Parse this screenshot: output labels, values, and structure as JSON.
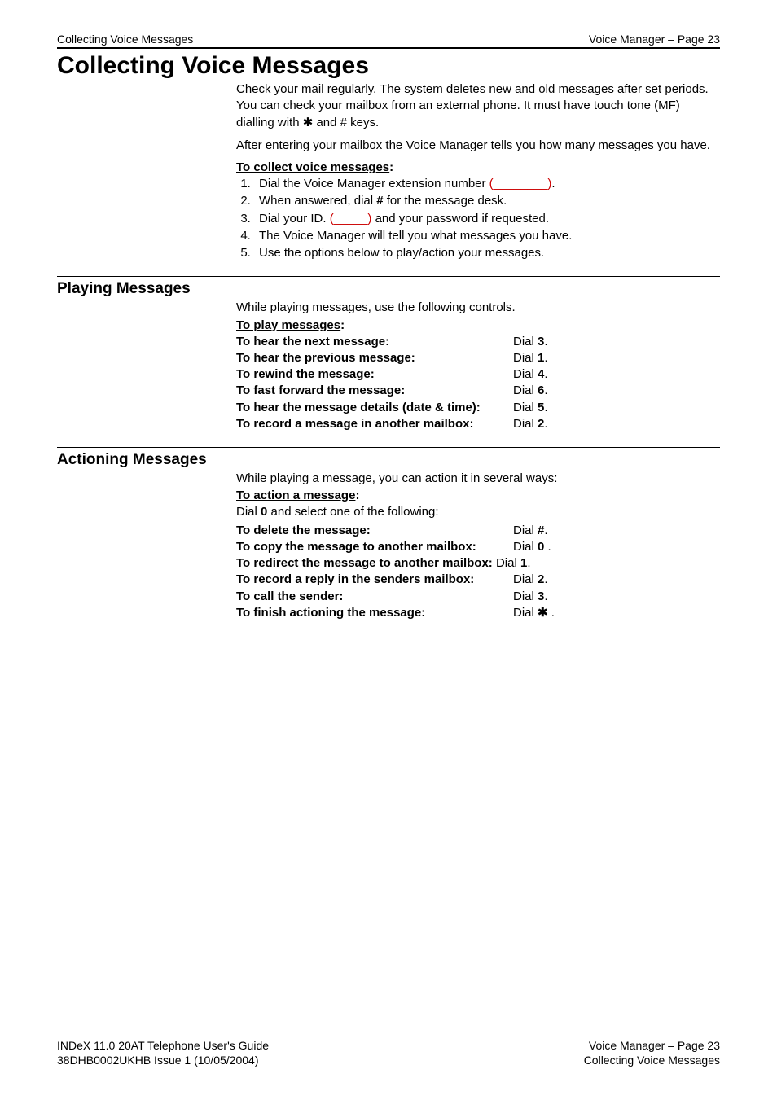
{
  "header": {
    "left": "Collecting Voice Messages",
    "right": "Voice Manager – Page 23"
  },
  "title": "Collecting Voice Messages",
  "intro": {
    "p1_a": "Check your mail regularly. The system deletes new and old messages after set periods. You can check your mailbox from an external phone. It must have touch tone (MF) dialling with ",
    "p1_star": "✱",
    "p1_b": " and # keys.",
    "p2": "After entering your mailbox the Voice Manager tells you how many messages you have."
  },
  "collect": {
    "heading": "To collect voice messages",
    "colon": ":",
    "step1_a": "Dial the Voice Manager extension number ",
    "step1_blank": "(________)",
    "step1_b": ".",
    "step2_a": "When answered, dial ",
    "step2_hash": "#",
    "step2_b": " for the message desk.",
    "step3_a": "Dial your ID. ",
    "step3_blank": "(_____)",
    "step3_b": " and your password if requested.",
    "step4": "The Voice Manager will tell you what messages you have.",
    "step5": "Use the options below to play/action your messages."
  },
  "playing": {
    "heading": "Playing Messages",
    "intro": "While playing messages, use the following controls.",
    "sub": "To play messages",
    "colon": ":",
    "rows": [
      {
        "label": "To hear the next message:",
        "pre": "Dial ",
        "key": "3",
        "post": "."
      },
      {
        "label": "To hear the previous message:",
        "pre": "Dial ",
        "key": "1",
        "post": "."
      },
      {
        "label": "To rewind the message:",
        "pre": "Dial ",
        "key": "4",
        "post": "."
      },
      {
        "label": "To fast forward the message:",
        "pre": "Dial ",
        "key": "6",
        "post": "."
      },
      {
        "label": "To hear the message details (date & time):",
        "pre": "Dial ",
        "key": "5",
        "post": "."
      },
      {
        "label": "To record a message in another mailbox:",
        "pre": "Dial ",
        "key": "2",
        "post": "."
      }
    ]
  },
  "actioning": {
    "heading": "Actioning Messages",
    "intro": "While playing a message, you can action it in several ways:",
    "sub": "To action a message",
    "colon": ":",
    "dial0_a": "Dial ",
    "dial0_key": "0",
    "dial0_b": " and select one of the following:",
    "rows": [
      {
        "label": "To delete the message:",
        "pre": "Dial ",
        "key": "#",
        "post": "."
      },
      {
        "label": "To copy the message to another mailbox:",
        "pre": "Dial ",
        "key": "0",
        "post": " ."
      }
    ],
    "redirect_label": "To redirect the message to another mailbox:",
    "redirect_pre": " Dial ",
    "redirect_key": "1",
    "redirect_post": ".",
    "rows2": [
      {
        "label": "To record a reply in the senders mailbox:",
        "pre": "Dial ",
        "key": "2",
        "post": "."
      },
      {
        "label": "To call the sender:",
        "pre": "Dial ",
        "key": "3",
        "post": "."
      },
      {
        "label": "To finish actioning the message:",
        "pre": "Dial ",
        "key": "✱",
        "post": " ."
      }
    ]
  },
  "footer": {
    "l1": "INDeX 11.0 20AT Telephone User's Guide",
    "l2": "38DHB0002UKHB Issue 1 (10/05/2004)",
    "r1": "Voice Manager – Page 23",
    "r2": "Collecting Voice Messages"
  }
}
